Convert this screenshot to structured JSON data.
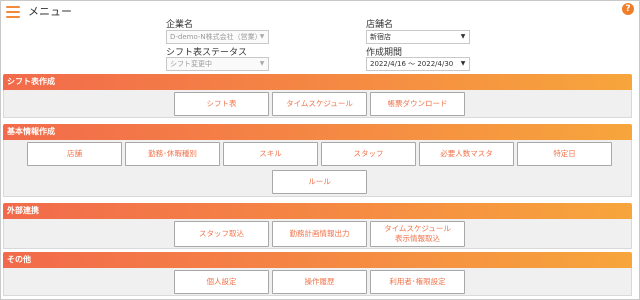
{
  "header": {
    "title": "メニュー",
    "help_symbol": "?"
  },
  "filters": {
    "company": {
      "label": "企業名",
      "value": "D-demo-N株式会社（営業）"
    },
    "store": {
      "label": "店舗名",
      "value": "新宿店"
    },
    "shift_status": {
      "label": "シフト表ステータス",
      "value": "シフト変更中"
    },
    "period": {
      "label": "作成期間",
      "value": "2022/4/16 ～ 2022/4/30"
    }
  },
  "sections": {
    "shift": {
      "title": "シフト表作成",
      "buttons": [
        "シフト表",
        "タイムスケジュール",
        "帳票ダウンロード"
      ]
    },
    "basic": {
      "title": "基本情報作成",
      "buttons": [
        "店舗",
        "勤務･休暇種別",
        "スキル",
        "スタッフ",
        "必要人数マスタ",
        "特定日",
        "ルール"
      ]
    },
    "external": {
      "title": "外部連携",
      "buttons": [
        "スタッフ取込",
        "勤務計画情報出力",
        "タイムスケジュール\n表示情報取込"
      ]
    },
    "other": {
      "title": "その他",
      "buttons": [
        "個人設定",
        "操作履歴",
        "利用者･権限設定"
      ]
    }
  },
  "colors": {
    "accent": "#f07d2a",
    "header_start": "#f26a4b",
    "header_end": "#f7a53c",
    "button_text": "#f0734a"
  }
}
